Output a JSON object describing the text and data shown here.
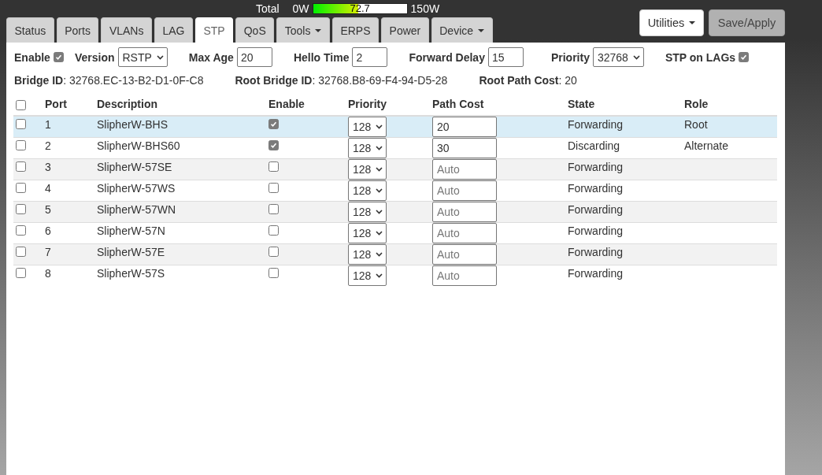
{
  "power": {
    "label": "Total",
    "min": "0W",
    "max": "150W",
    "reading": "72.7",
    "level": 0.485
  },
  "tabs": [
    {
      "label": "Status",
      "selected": false,
      "dropdown": false
    },
    {
      "label": "Ports",
      "selected": false,
      "dropdown": false
    },
    {
      "label": "VLANs",
      "selected": false,
      "dropdown": false
    },
    {
      "label": "LAG",
      "selected": false,
      "dropdown": false
    },
    {
      "label": "STP",
      "selected": true,
      "dropdown": false
    },
    {
      "label": "QoS",
      "selected": false,
      "dropdown": false
    },
    {
      "label": "Tools",
      "selected": false,
      "dropdown": true
    },
    {
      "label": "ERPS",
      "selected": false,
      "dropdown": false
    },
    {
      "label": "Power",
      "selected": false,
      "dropdown": false
    },
    {
      "label": "Device",
      "selected": false,
      "dropdown": true
    }
  ],
  "actions": [
    {
      "label": "Utilities",
      "kind": "menu"
    },
    {
      "label": "Save/Apply",
      "kind": "apply"
    }
  ],
  "settings": [
    {
      "kind": "checkbox",
      "label": "Enable",
      "checked": true
    },
    {
      "kind": "select",
      "label": "Version",
      "value": "RSTP"
    },
    {
      "kind": "input",
      "label": "Max Age",
      "value": "20"
    },
    {
      "kind": "input",
      "label": "Hello Time",
      "value": "2"
    },
    {
      "kind": "input",
      "label": "Forward Delay",
      "value": "15"
    },
    {
      "kind": "select",
      "label": "Priority",
      "value": "32768"
    },
    {
      "kind": "checkbox",
      "label": "STP on LAGs",
      "checked": true
    }
  ],
  "bridge_info": [
    "**Bridge ID**: 32768.EC-13-B2-D1-0F-C8",
    "**Root Bridge ID**: 32768.B8-69-F4-94-D5-28",
    "**Root Path Cost**: 20"
  ],
  "table": {
    "select_all": {
      "checked": false
    },
    "columns": [
      "Port",
      "Description",
      "Enable",
      "Priority",
      "Path Cost",
      "State",
      "Role"
    ],
    "rows": [
      {
        "highlighted": true,
        "checked": false,
        "port": "1",
        "description": "SlipherW-BHS",
        "enabled": true,
        "priority": "128",
        "path_cost": {
          "value": "20"
        },
        "state": "Forwarding",
        "role": "Root"
      },
      {
        "highlighted": false,
        "checked": false,
        "port": "2",
        "description": "SlipherW-BHS60",
        "enabled": true,
        "priority": "128",
        "path_cost": {
          "value": "30"
        },
        "state": "Discarding",
        "role": "Alternate"
      },
      {
        "highlighted": false,
        "checked": false,
        "port": "3",
        "description": "SlipherW-57SE",
        "enabled": false,
        "priority": "128",
        "path_cost": {
          "placeholder": "Auto"
        },
        "state": "Forwarding"
      },
      {
        "highlighted": false,
        "checked": false,
        "port": "4",
        "description": "SlipherW-57WS",
        "enabled": false,
        "priority": "128",
        "path_cost": {
          "placeholder": "Auto"
        },
        "state": "Forwarding"
      },
      {
        "highlighted": false,
        "checked": false,
        "port": "5",
        "description": "SlipherW-57WN",
        "enabled": false,
        "priority": "128",
        "path_cost": {
          "placeholder": "Auto"
        },
        "state": "Forwarding"
      },
      {
        "highlighted": false,
        "checked": false,
        "port": "6",
        "description": "SlipherW-57N",
        "enabled": false,
        "priority": "128",
        "path_cost": {
          "placeholder": "Auto"
        },
        "state": "Forwarding"
      },
      {
        "highlighted": false,
        "checked": false,
        "port": "7",
        "description": "SlipherW-57E",
        "enabled": false,
        "priority": "128",
        "path_cost": {
          "placeholder": "Auto"
        },
        "state": "Forwarding"
      },
      {
        "highlighted": false,
        "checked": false,
        "port": "8",
        "description": "SlipherW-57S",
        "enabled": false,
        "priority": "128",
        "path_cost": {
          "placeholder": "Auto"
        },
        "state": "Forwarding"
      }
    ]
  }
}
